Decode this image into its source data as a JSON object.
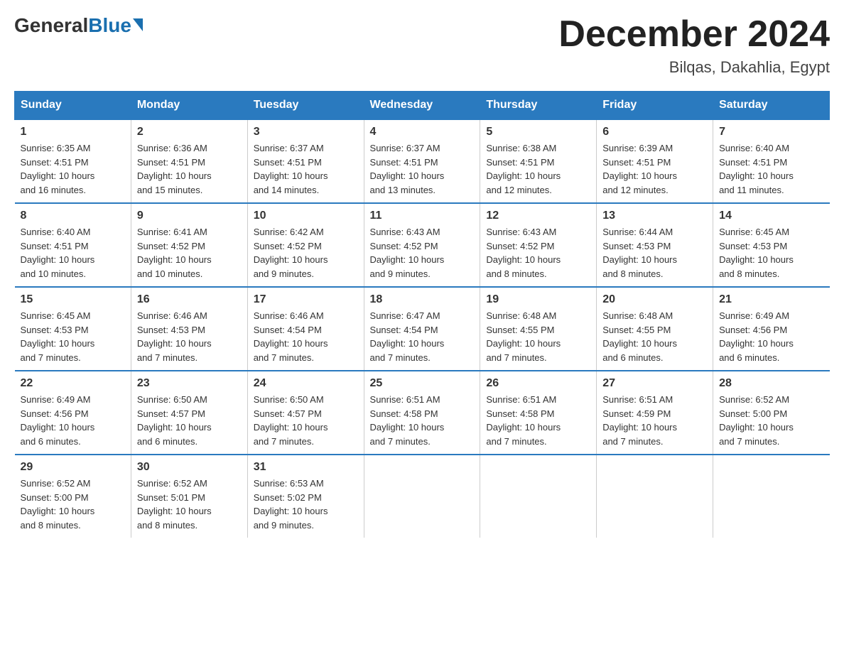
{
  "header": {
    "logo_general": "General",
    "logo_blue": "Blue",
    "month_title": "December 2024",
    "location": "Bilqas, Dakahlia, Egypt"
  },
  "weekdays": [
    "Sunday",
    "Monday",
    "Tuesday",
    "Wednesday",
    "Thursday",
    "Friday",
    "Saturday"
  ],
  "weeks": [
    [
      {
        "day": "1",
        "info": "Sunrise: 6:35 AM\nSunset: 4:51 PM\nDaylight: 10 hours\nand 16 minutes."
      },
      {
        "day": "2",
        "info": "Sunrise: 6:36 AM\nSunset: 4:51 PM\nDaylight: 10 hours\nand 15 minutes."
      },
      {
        "day": "3",
        "info": "Sunrise: 6:37 AM\nSunset: 4:51 PM\nDaylight: 10 hours\nand 14 minutes."
      },
      {
        "day": "4",
        "info": "Sunrise: 6:37 AM\nSunset: 4:51 PM\nDaylight: 10 hours\nand 13 minutes."
      },
      {
        "day": "5",
        "info": "Sunrise: 6:38 AM\nSunset: 4:51 PM\nDaylight: 10 hours\nand 12 minutes."
      },
      {
        "day": "6",
        "info": "Sunrise: 6:39 AM\nSunset: 4:51 PM\nDaylight: 10 hours\nand 12 minutes."
      },
      {
        "day": "7",
        "info": "Sunrise: 6:40 AM\nSunset: 4:51 PM\nDaylight: 10 hours\nand 11 minutes."
      }
    ],
    [
      {
        "day": "8",
        "info": "Sunrise: 6:40 AM\nSunset: 4:51 PM\nDaylight: 10 hours\nand 10 minutes."
      },
      {
        "day": "9",
        "info": "Sunrise: 6:41 AM\nSunset: 4:52 PM\nDaylight: 10 hours\nand 10 minutes."
      },
      {
        "day": "10",
        "info": "Sunrise: 6:42 AM\nSunset: 4:52 PM\nDaylight: 10 hours\nand 9 minutes."
      },
      {
        "day": "11",
        "info": "Sunrise: 6:43 AM\nSunset: 4:52 PM\nDaylight: 10 hours\nand 9 minutes."
      },
      {
        "day": "12",
        "info": "Sunrise: 6:43 AM\nSunset: 4:52 PM\nDaylight: 10 hours\nand 8 minutes."
      },
      {
        "day": "13",
        "info": "Sunrise: 6:44 AM\nSunset: 4:53 PM\nDaylight: 10 hours\nand 8 minutes."
      },
      {
        "day": "14",
        "info": "Sunrise: 6:45 AM\nSunset: 4:53 PM\nDaylight: 10 hours\nand 8 minutes."
      }
    ],
    [
      {
        "day": "15",
        "info": "Sunrise: 6:45 AM\nSunset: 4:53 PM\nDaylight: 10 hours\nand 7 minutes."
      },
      {
        "day": "16",
        "info": "Sunrise: 6:46 AM\nSunset: 4:53 PM\nDaylight: 10 hours\nand 7 minutes."
      },
      {
        "day": "17",
        "info": "Sunrise: 6:46 AM\nSunset: 4:54 PM\nDaylight: 10 hours\nand 7 minutes."
      },
      {
        "day": "18",
        "info": "Sunrise: 6:47 AM\nSunset: 4:54 PM\nDaylight: 10 hours\nand 7 minutes."
      },
      {
        "day": "19",
        "info": "Sunrise: 6:48 AM\nSunset: 4:55 PM\nDaylight: 10 hours\nand 7 minutes."
      },
      {
        "day": "20",
        "info": "Sunrise: 6:48 AM\nSunset: 4:55 PM\nDaylight: 10 hours\nand 6 minutes."
      },
      {
        "day": "21",
        "info": "Sunrise: 6:49 AM\nSunset: 4:56 PM\nDaylight: 10 hours\nand 6 minutes."
      }
    ],
    [
      {
        "day": "22",
        "info": "Sunrise: 6:49 AM\nSunset: 4:56 PM\nDaylight: 10 hours\nand 6 minutes."
      },
      {
        "day": "23",
        "info": "Sunrise: 6:50 AM\nSunset: 4:57 PM\nDaylight: 10 hours\nand 6 minutes."
      },
      {
        "day": "24",
        "info": "Sunrise: 6:50 AM\nSunset: 4:57 PM\nDaylight: 10 hours\nand 7 minutes."
      },
      {
        "day": "25",
        "info": "Sunrise: 6:51 AM\nSunset: 4:58 PM\nDaylight: 10 hours\nand 7 minutes."
      },
      {
        "day": "26",
        "info": "Sunrise: 6:51 AM\nSunset: 4:58 PM\nDaylight: 10 hours\nand 7 minutes."
      },
      {
        "day": "27",
        "info": "Sunrise: 6:51 AM\nSunset: 4:59 PM\nDaylight: 10 hours\nand 7 minutes."
      },
      {
        "day": "28",
        "info": "Sunrise: 6:52 AM\nSunset: 5:00 PM\nDaylight: 10 hours\nand 7 minutes."
      }
    ],
    [
      {
        "day": "29",
        "info": "Sunrise: 6:52 AM\nSunset: 5:00 PM\nDaylight: 10 hours\nand 8 minutes."
      },
      {
        "day": "30",
        "info": "Sunrise: 6:52 AM\nSunset: 5:01 PM\nDaylight: 10 hours\nand 8 minutes."
      },
      {
        "day": "31",
        "info": "Sunrise: 6:53 AM\nSunset: 5:02 PM\nDaylight: 10 hours\nand 9 minutes."
      },
      {
        "day": "",
        "info": ""
      },
      {
        "day": "",
        "info": ""
      },
      {
        "day": "",
        "info": ""
      },
      {
        "day": "",
        "info": ""
      }
    ]
  ]
}
